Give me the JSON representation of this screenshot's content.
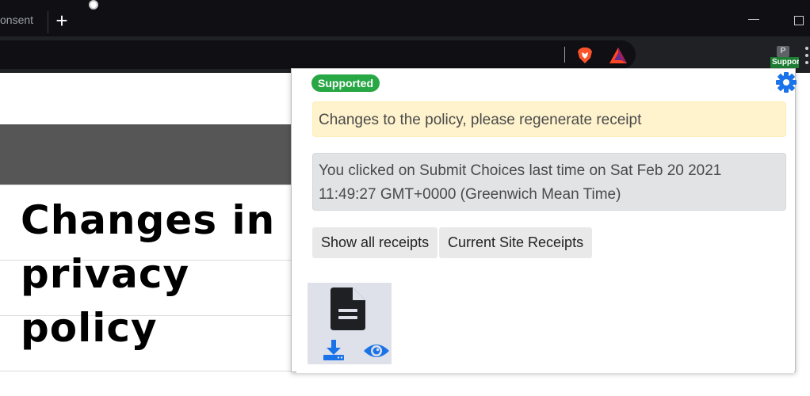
{
  "browser": {
    "tab_title": "onsent",
    "new_tab_label": "+",
    "extension_badge": "Supported"
  },
  "page": {
    "heading": "Changes in privacy policy"
  },
  "popup": {
    "status_badge": "Supported",
    "url_value": "",
    "alert_warning": "Changes to the policy, please regenerate receipt",
    "alert_info": "You clicked on Submit Choices last time on Sat Feb 20 2021 11:49:27 GMT+0000 (Greenwich Mean Time)",
    "buttons": {
      "show_all": "Show all receipts",
      "current_site": "Current Site Receipts"
    },
    "icons": {
      "settings": "gear-icon",
      "receipt": "document-icon",
      "download": "download-icon",
      "view": "eye-icon"
    }
  },
  "colors": {
    "supported_badge": "#28a745",
    "warning_bg": "#fff3cd",
    "info_bg": "#e2e3e5",
    "accent_blue": "#1a73e8"
  }
}
